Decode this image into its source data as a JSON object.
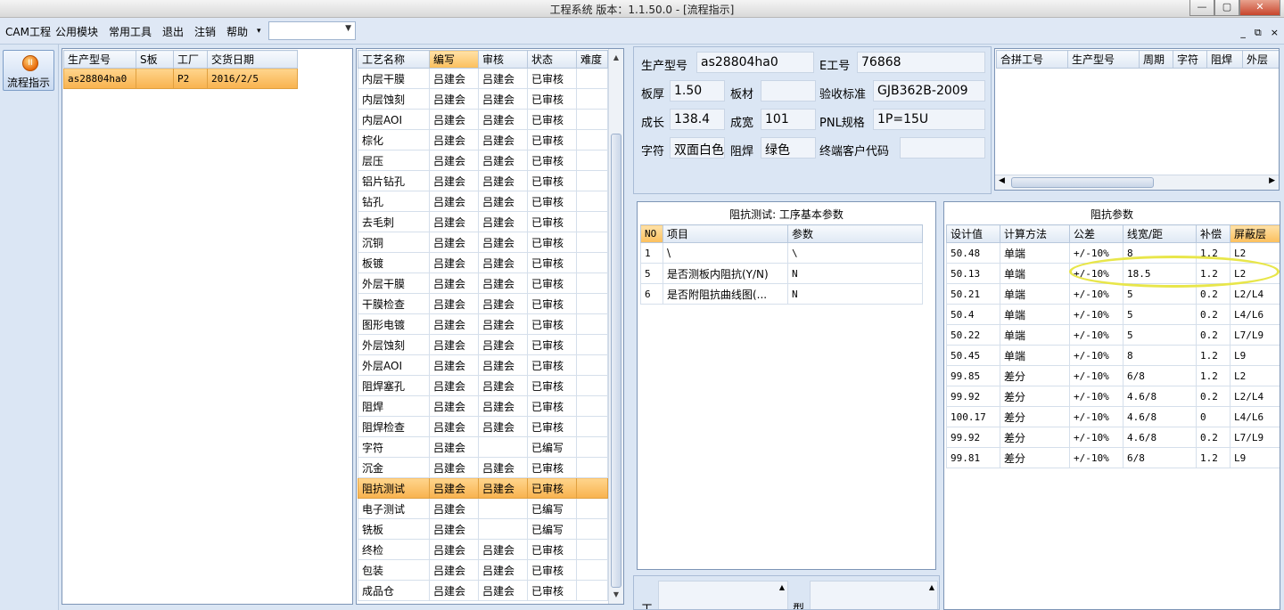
{
  "window": {
    "title": "工程系统   版本：1.1.50.0 - [流程指示]",
    "controls": {
      "min": "—",
      "max": "▢",
      "close": "✕"
    }
  },
  "menu": {
    "items": [
      "CAM工程",
      "公用模块",
      "常用工具",
      "退出",
      "注销",
      "帮助"
    ],
    "help_arrow": "▾",
    "combo_value": "",
    "combo_arrow": "▼",
    "mdi": [
      "_",
      "⧉",
      "×"
    ]
  },
  "toolbar": {
    "flow_label": "流程指示",
    "flow_icon_text": "II"
  },
  "orders": {
    "headers": [
      "生产型号",
      "S板",
      "工厂",
      "交货日期"
    ],
    "rows": [
      [
        "as28804ha0",
        "",
        "P2",
        "2016/2/5"
      ]
    ]
  },
  "process": {
    "headers": [
      "工艺名称",
      "编写",
      "审核",
      "状态",
      "难度"
    ],
    "rows": [
      [
        "内层干膜",
        "吕建会",
        "吕建会",
        "已审核",
        ""
      ],
      [
        "内层蚀刻",
        "吕建会",
        "吕建会",
        "已审核",
        ""
      ],
      [
        "内层AOI",
        "吕建会",
        "吕建会",
        "已审核",
        ""
      ],
      [
        "棕化",
        "吕建会",
        "吕建会",
        "已审核",
        ""
      ],
      [
        "层压",
        "吕建会",
        "吕建会",
        "已审核",
        ""
      ],
      [
        "铝片钻孔",
        "吕建会",
        "吕建会",
        "已审核",
        ""
      ],
      [
        "钻孔",
        "吕建会",
        "吕建会",
        "已审核",
        ""
      ],
      [
        "去毛刺",
        "吕建会",
        "吕建会",
        "已审核",
        ""
      ],
      [
        "沉铜",
        "吕建会",
        "吕建会",
        "已审核",
        ""
      ],
      [
        "板镀",
        "吕建会",
        "吕建会",
        "已审核",
        ""
      ],
      [
        "外层干膜",
        "吕建会",
        "吕建会",
        "已审核",
        ""
      ],
      [
        "干膜检查",
        "吕建会",
        "吕建会",
        "已审核",
        ""
      ],
      [
        "图形电镀",
        "吕建会",
        "吕建会",
        "已审核",
        ""
      ],
      [
        "外层蚀刻",
        "吕建会",
        "吕建会",
        "已审核",
        ""
      ],
      [
        "外层AOI",
        "吕建会",
        "吕建会",
        "已审核",
        ""
      ],
      [
        "阻焊塞孔",
        "吕建会",
        "吕建会",
        "已审核",
        ""
      ],
      [
        "阻焊",
        "吕建会",
        "吕建会",
        "已审核",
        ""
      ],
      [
        "阻焊检查",
        "吕建会",
        "吕建会",
        "已审核",
        ""
      ],
      [
        "字符",
        "吕建会",
        "",
        "已编写",
        ""
      ],
      [
        "沉金",
        "吕建会",
        "吕建会",
        "已审核",
        ""
      ],
      [
        "阻抗测试",
        "吕建会",
        "吕建会",
        "已审核",
        ""
      ],
      [
        "电子测试",
        "吕建会",
        "",
        "已编写",
        ""
      ],
      [
        "铣板",
        "吕建会",
        "",
        "已编写",
        ""
      ],
      [
        "终检",
        "吕建会",
        "吕建会",
        "已审核",
        ""
      ],
      [
        "包装",
        "吕建会",
        "吕建会",
        "已审核",
        ""
      ],
      [
        "成品仓",
        "吕建会",
        "吕建会",
        "已审核",
        ""
      ]
    ],
    "selected_index": 20
  },
  "info": {
    "labels": {
      "model": "生产型号",
      "e_no": "E工号",
      "thickness": "板厚",
      "material": "板材",
      "standard": "验收标准",
      "len": "成长",
      "wid": "成宽",
      "pnl": "PNL规格",
      "char": "字符",
      "mask": "阻焊",
      "client": "终端客户代码"
    },
    "values": {
      "model": "as28804ha0",
      "e_no": "76868",
      "thickness": "1.50",
      "material": "",
      "standard": "GJB362B-2009",
      "len": "138.4",
      "wid": "101",
      "pnl": "1P=15U",
      "char": "双面白色",
      "mask": "绿色",
      "client": ""
    }
  },
  "merge": {
    "headers": [
      "合拼工号",
      "生产型号",
      "周期",
      "字符",
      "阻焊",
      "外层"
    ]
  },
  "impedance_test": {
    "title": "阻抗测试: 工序基本参数",
    "headers": [
      "NO",
      "项目",
      "参数"
    ],
    "rows": [
      [
        "1",
        "\\",
        "\\"
      ],
      [
        "5",
        "是否测板内阻抗(Y/N)",
        "N"
      ],
      [
        "6",
        "是否附阻抗曲线图(...",
        "N"
      ]
    ]
  },
  "impedance_params": {
    "title": "阻抗参数",
    "headers": [
      "设计值",
      "计算方法",
      "公差",
      "线宽/距",
      "补偿",
      "屏蔽层"
    ],
    "rows": [
      [
        "50.48",
        "单端",
        "+/-10%",
        "8",
        "1.2",
        "L2"
      ],
      [
        "50.13",
        "单端",
        "+/-10%",
        "18.5",
        "1.2",
        "L2"
      ],
      [
        "50.21",
        "单端",
        "+/-10%",
        "5",
        "0.2",
        "L2/L4"
      ],
      [
        "50.4",
        "单端",
        "+/-10%",
        "5",
        "0.2",
        "L4/L6"
      ],
      [
        "50.22",
        "单端",
        "+/-10%",
        "5",
        "0.2",
        "L7/L9"
      ],
      [
        "50.45",
        "单端",
        "+/-10%",
        "8",
        "1.2",
        "L9"
      ],
      [
        "99.85",
        "差分",
        "+/-10%",
        "6/8",
        "1.2",
        "L2"
      ],
      [
        "99.92",
        "差分",
        "+/-10%",
        "4.6/8",
        "0.2",
        "L2/L4"
      ],
      [
        "100.17",
        "差分",
        "+/-10%",
        "4.6/8",
        "0",
        "L4/L6"
      ],
      [
        "99.92",
        "差分",
        "+/-10%",
        "4.6/8",
        "0.2",
        "L7/L9"
      ],
      [
        "99.81",
        "差分",
        "+/-10%",
        "6/8",
        "1.2",
        "L9"
      ]
    ]
  },
  "bottom": {
    "label1": "工",
    "label2": "型"
  }
}
